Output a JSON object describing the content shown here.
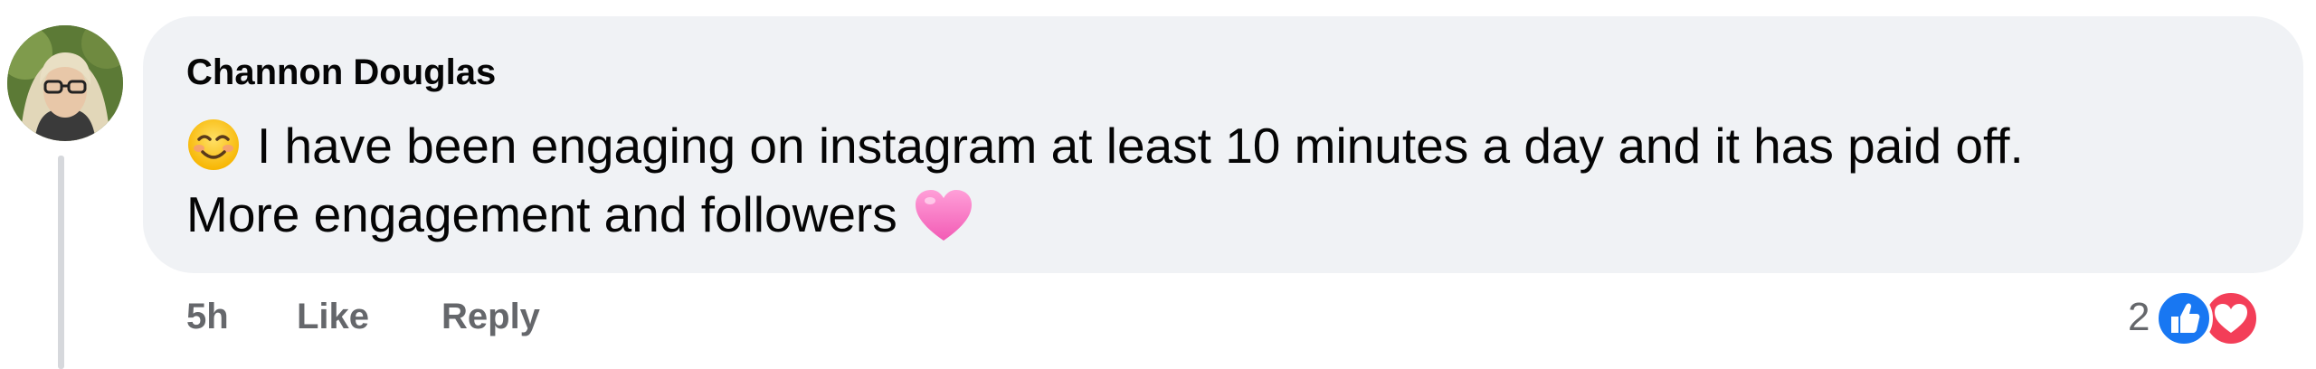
{
  "comment": {
    "author": "Channon Douglas",
    "lines": [
      "I have been engaging on instagram at least 10 minutes a day and it has paid off.",
      "More engagement and followers"
    ],
    "emojis": [
      "smiling-face-icon",
      "pink-heart-icon"
    ]
  },
  "actions": {
    "time": "5h",
    "like": "Like",
    "reply": "Reply"
  },
  "reactions": {
    "count": "2",
    "types": [
      "like-reaction-icon",
      "love-reaction-icon"
    ]
  },
  "colors": {
    "bubble": "#f0f2f5",
    "text": "#050505",
    "secondary": "#65676b",
    "like_blue": "#1877f2",
    "love_red": "#f33e58"
  }
}
